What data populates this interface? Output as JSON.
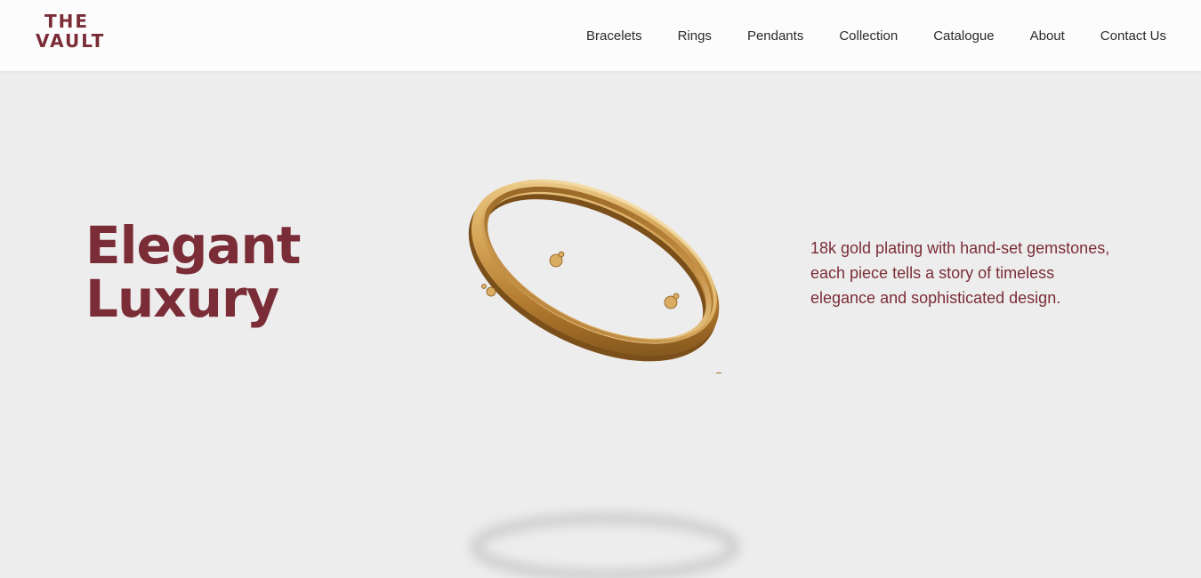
{
  "brand": {
    "line1": "THE",
    "line2": "VAULT",
    "color": "#7a2d37"
  },
  "nav": {
    "items": [
      {
        "label": "Bracelets"
      },
      {
        "label": "Rings"
      },
      {
        "label": "Pendants"
      },
      {
        "label": "Collection"
      },
      {
        "label": "Catalogue"
      },
      {
        "label": "About"
      },
      {
        "label": "Contact Us"
      }
    ]
  },
  "hero": {
    "headline_line1": "Elegant",
    "headline_line2": "Luxury",
    "description": "18k gold plating with hand-set gemstones, each piece tells a story of timeless elegance and sophisticated design.",
    "image": "gold-bracelet-image",
    "background": "#eeeded",
    "accent_gold": "#c9994d"
  }
}
